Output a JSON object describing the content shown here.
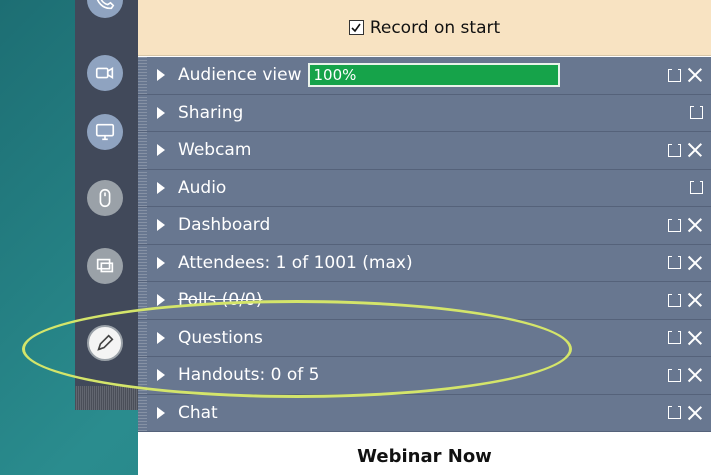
{
  "record_bar": {
    "label": "Record on start",
    "checked": true
  },
  "rows": [
    {
      "label": "Audience view",
      "progress_text": "100%",
      "progress": 100,
      "closable": true,
      "strike": false
    },
    {
      "label": "Sharing",
      "closable": false,
      "strike": false
    },
    {
      "label": "Webcam",
      "closable": true,
      "strike": false
    },
    {
      "label": "Audio",
      "closable": false,
      "strike": false
    },
    {
      "label": "Dashboard",
      "closable": true,
      "strike": false
    },
    {
      "label": "Attendees: 1 of 1001 (max)",
      "closable": true,
      "strike": false
    },
    {
      "label": "Polls (0/0)",
      "closable": true,
      "strike": true
    },
    {
      "label": "Questions",
      "closable": true,
      "strike": false
    },
    {
      "label": "Handouts: 0 of 5",
      "closable": true,
      "strike": false
    },
    {
      "label": "Chat",
      "closable": true,
      "strike": false
    }
  ],
  "footer": {
    "title": "Webinar Now"
  },
  "toolbar_icons": [
    "phone-icon",
    "webcam-icon",
    "screen-icon",
    "mouse-icon",
    "screens-icon",
    "pen-icon"
  ],
  "colors": {
    "row_bg": "#687790",
    "progress": "#16a34a",
    "record_bar": "#f8e3c2",
    "highlight": "#d4e56a"
  }
}
